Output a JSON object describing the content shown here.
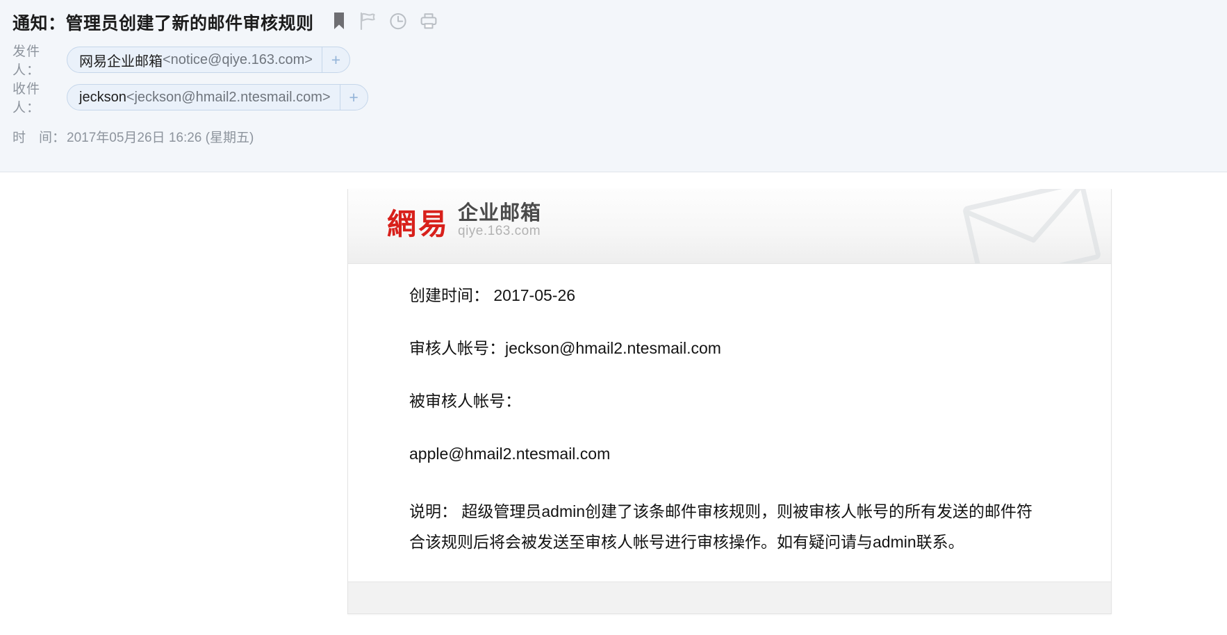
{
  "header": {
    "subject": "通知：管理员创建了新的邮件审核规则",
    "icons": [
      {
        "name": "bookmark-icon",
        "title": "标记"
      },
      {
        "name": "flag-icon",
        "title": "红旗标记"
      },
      {
        "name": "clock-icon",
        "title": "定时"
      },
      {
        "name": "printer-icon",
        "title": "打印"
      }
    ],
    "from": {
      "label": "发件人：",
      "name": "网易企业邮箱",
      "email": "<notice@qiye.163.com>",
      "add_label": "+"
    },
    "to": {
      "label": "收件人：",
      "name": "jeckson",
      "email": "<jeckson@hmail2.ntesmail.com>",
      "add_label": "+"
    },
    "time": {
      "label": "时　间：",
      "value": "2017年05月26日 16:26 (星期五)"
    }
  },
  "card": {
    "logo": {
      "brand_cn": "網易",
      "product_cn": "企业邮箱",
      "product_en": "qiye.163.com",
      "brand_color": "#d8201b",
      "watermark": "envelope-watermark"
    },
    "lines": [
      "创建时间： 2017-05-26",
      "审核人帐号：jeckson@hmail2.ntesmail.com",
      "被审核人帐号：",
      "apple@hmail2.ntesmail.com"
    ],
    "description": "说明： 超级管理员admin创建了该条邮件审核规则，则被审核人帐号的所有发送的邮件符合该规则后将会被发送至审核人帐号进行审核操作。如有疑问请与admin联系。"
  }
}
